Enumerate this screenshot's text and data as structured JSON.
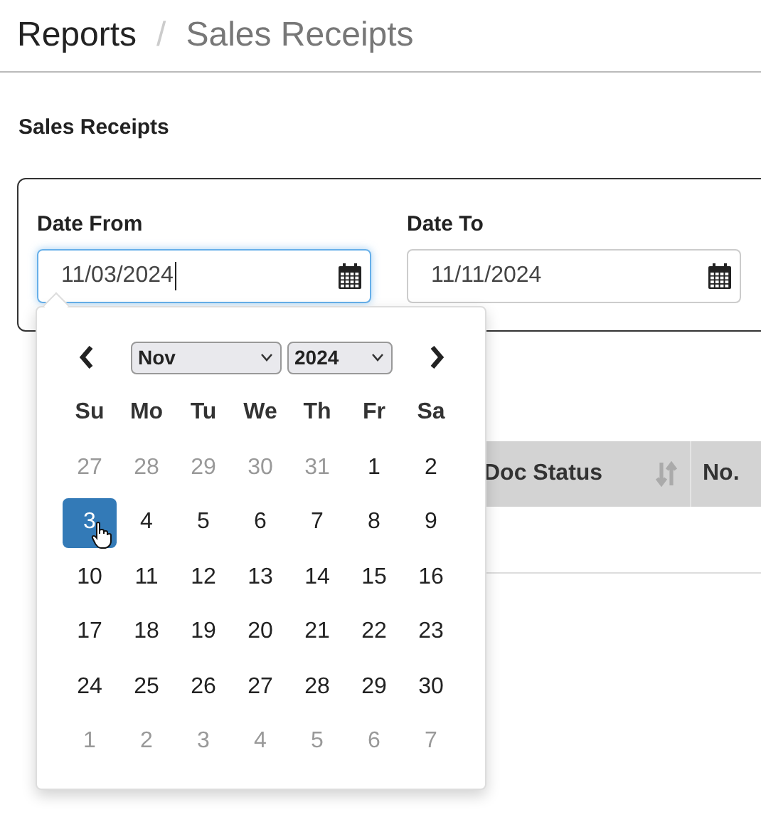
{
  "breadcrumb": [
    {
      "label": "Reports",
      "current": false
    },
    {
      "label": "Sales Receipts",
      "current": true
    }
  ],
  "separator": "/",
  "heading": "Sales Receipts",
  "fields": [
    {
      "label": "Date From",
      "value": "11/03/2024",
      "focused": true
    },
    {
      "label": "Date To",
      "value": "11/11/2024",
      "focused": false
    }
  ],
  "datepicker": {
    "month": "Nov",
    "year": "2024",
    "weekdays": [
      "Su",
      "Mo",
      "Tu",
      "We",
      "Th",
      "Fr",
      "Sa"
    ],
    "weeks": [
      [
        {
          "day": "27",
          "outside": true,
          "selected": false
        },
        {
          "day": "28",
          "outside": true,
          "selected": false
        },
        {
          "day": "29",
          "outside": true,
          "selected": false
        },
        {
          "day": "30",
          "outside": true,
          "selected": false
        },
        {
          "day": "31",
          "outside": true,
          "selected": false
        },
        {
          "day": "1",
          "outside": false,
          "selected": false
        },
        {
          "day": "2",
          "outside": false,
          "selected": false
        }
      ],
      [
        {
          "day": "3",
          "outside": false,
          "selected": true
        },
        {
          "day": "4",
          "outside": false,
          "selected": false
        },
        {
          "day": "5",
          "outside": false,
          "selected": false
        },
        {
          "day": "6",
          "outside": false,
          "selected": false
        },
        {
          "day": "7",
          "outside": false,
          "selected": false
        },
        {
          "day": "8",
          "outside": false,
          "selected": false
        },
        {
          "day": "9",
          "outside": false,
          "selected": false
        }
      ],
      [
        {
          "day": "10",
          "outside": false,
          "selected": false
        },
        {
          "day": "11",
          "outside": false,
          "selected": false
        },
        {
          "day": "12",
          "outside": false,
          "selected": false
        },
        {
          "day": "13",
          "outside": false,
          "selected": false
        },
        {
          "day": "14",
          "outside": false,
          "selected": false
        },
        {
          "day": "15",
          "outside": false,
          "selected": false
        },
        {
          "day": "16",
          "outside": false,
          "selected": false
        }
      ],
      [
        {
          "day": "17",
          "outside": false,
          "selected": false
        },
        {
          "day": "18",
          "outside": false,
          "selected": false
        },
        {
          "day": "19",
          "outside": false,
          "selected": false
        },
        {
          "day": "20",
          "outside": false,
          "selected": false
        },
        {
          "day": "21",
          "outside": false,
          "selected": false
        },
        {
          "day": "22",
          "outside": false,
          "selected": false
        },
        {
          "day": "23",
          "outside": false,
          "selected": false
        }
      ],
      [
        {
          "day": "24",
          "outside": false,
          "selected": false
        },
        {
          "day": "25",
          "outside": false,
          "selected": false
        },
        {
          "day": "26",
          "outside": false,
          "selected": false
        },
        {
          "day": "27",
          "outside": false,
          "selected": false
        },
        {
          "day": "28",
          "outside": false,
          "selected": false
        },
        {
          "day": "29",
          "outside": false,
          "selected": false
        },
        {
          "day": "30",
          "outside": false,
          "selected": false
        }
      ],
      [
        {
          "day": "1",
          "outside": true,
          "selected": false
        },
        {
          "day": "2",
          "outside": true,
          "selected": false
        },
        {
          "day": "3",
          "outside": true,
          "selected": false
        },
        {
          "day": "4",
          "outside": true,
          "selected": false
        },
        {
          "day": "5",
          "outside": true,
          "selected": false
        },
        {
          "day": "6",
          "outside": true,
          "selected": false
        },
        {
          "day": "7",
          "outside": true,
          "selected": false
        }
      ]
    ]
  },
  "table": {
    "columns": [
      {
        "label": "Doc Status",
        "sortable": true
      },
      {
        "label": "No."
      }
    ]
  }
}
